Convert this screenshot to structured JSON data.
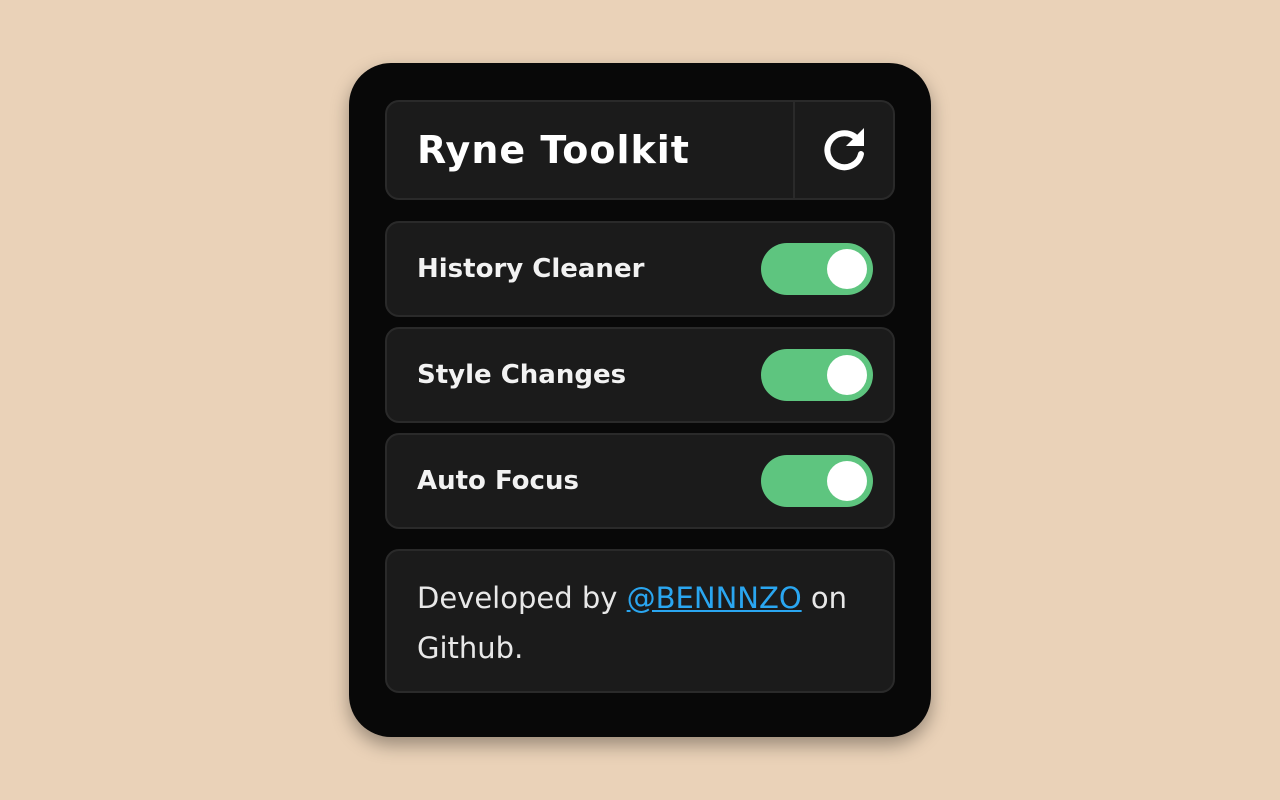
{
  "header": {
    "title": "Ryne Toolkit",
    "refresh_icon": "refresh-icon"
  },
  "settings": [
    {
      "label": "History Cleaner",
      "enabled": true
    },
    {
      "label": "Style Changes",
      "enabled": true
    },
    {
      "label": "Auto Focus",
      "enabled": true
    }
  ],
  "footer": {
    "prefix": "Developed by ",
    "link_text": "@BENNNZO",
    "suffix": " on Github."
  },
  "colors": {
    "background": "#ead2b8",
    "panel": "#080808",
    "card": "#1b1b1b",
    "toggle_on": "#5ec57f",
    "link": "#2aa6f0"
  }
}
